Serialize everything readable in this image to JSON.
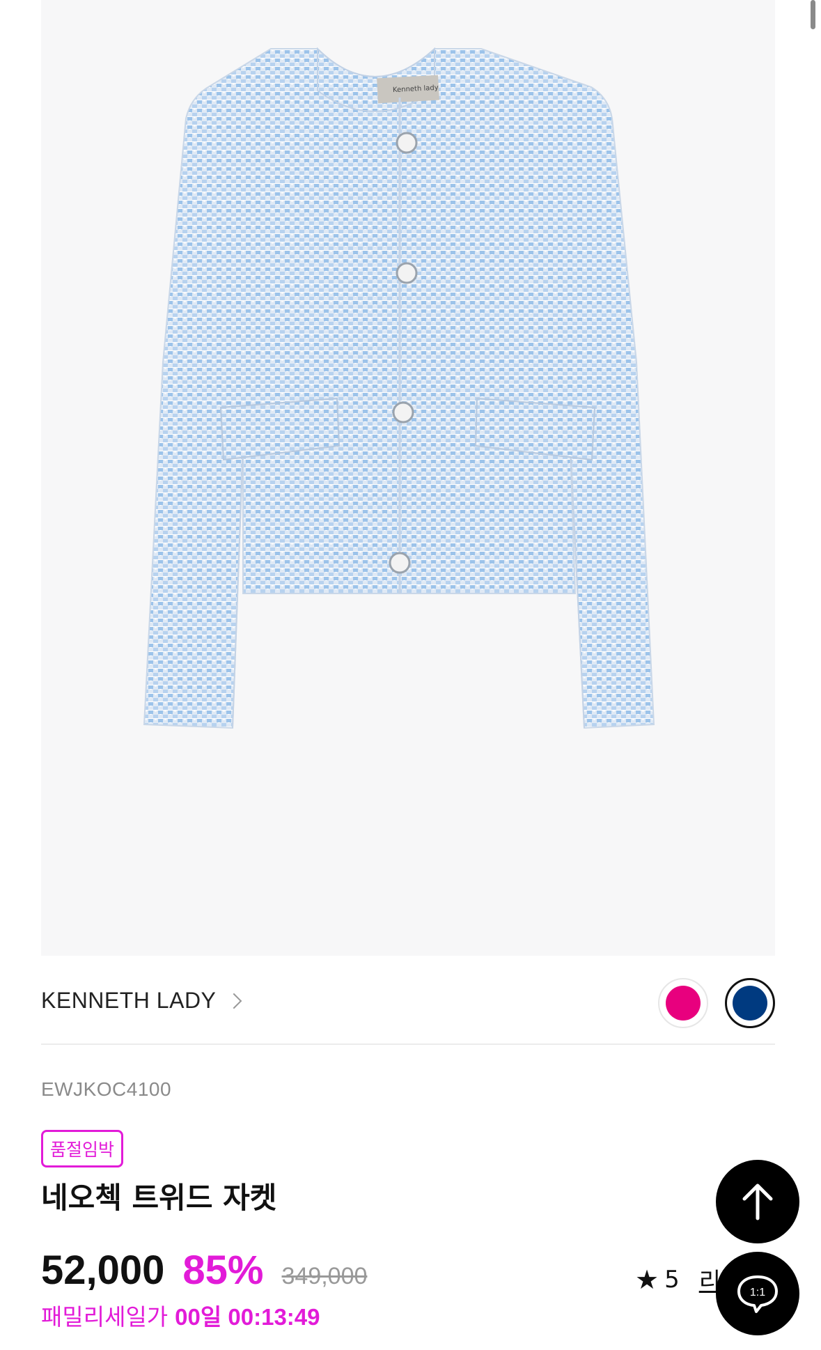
{
  "product": {
    "brand": "KENNETH LADY",
    "code": "EWJKOC4100",
    "badge": "품절임박",
    "name": "네오첵 트위드 자켓",
    "price": "52,000",
    "discount": "85%",
    "original_price": "349,000",
    "family_sale_label": "패밀리세일가",
    "countdown": "00일 00:13:49",
    "rating": "5",
    "review_label": "리뷰",
    "image_label_text": "Kenneth lady"
  },
  "colors": {
    "options": [
      {
        "name": "pink",
        "hex": "#e8007e",
        "selected": false
      },
      {
        "name": "navy",
        "hex": "#003a80",
        "selected": true
      }
    ],
    "accent": "#e21bd8"
  },
  "icons": {
    "scroll_top": "arrow-up-icon",
    "chat": "chat-bubble-icon",
    "star": "star-icon",
    "brand_chevron": "chevron-right-icon"
  },
  "chat": {
    "label": "1:1"
  }
}
